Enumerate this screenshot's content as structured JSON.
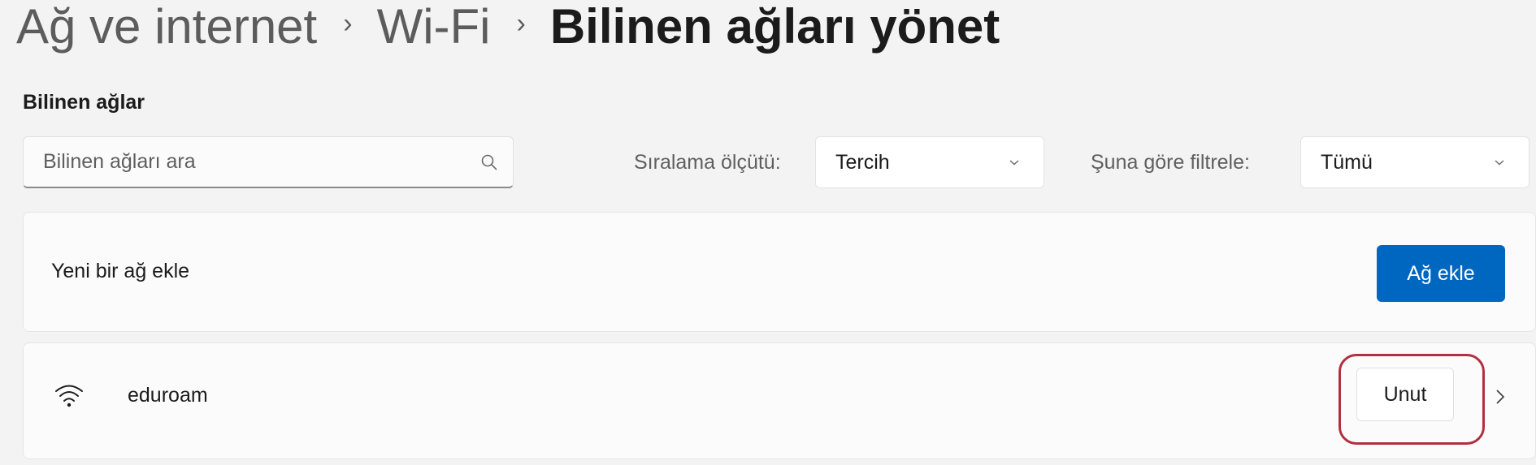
{
  "breadcrumb": {
    "items": [
      "Ağ ve internet",
      "Wi-Fi"
    ],
    "separator": "›",
    "current": "Bilinen ağları yönet"
  },
  "section": {
    "title": "Bilinen ağlar"
  },
  "search": {
    "placeholder": "Bilinen ağları ara",
    "icon": "search-icon"
  },
  "sort": {
    "label": "Sıralama ölçütü:",
    "selected": "Tercih"
  },
  "filter": {
    "label": "Şuna göre filtrele:",
    "selected": "Tümü"
  },
  "add_network": {
    "label": "Yeni bir ağ ekle",
    "button": "Ağ ekle"
  },
  "networks": [
    {
      "name": "eduroam",
      "icon": "wifi-icon",
      "forget_button": "Unut"
    }
  ],
  "colors": {
    "accent": "#0067c0",
    "highlight": "#b0303f",
    "background": "#f3f3f3"
  }
}
